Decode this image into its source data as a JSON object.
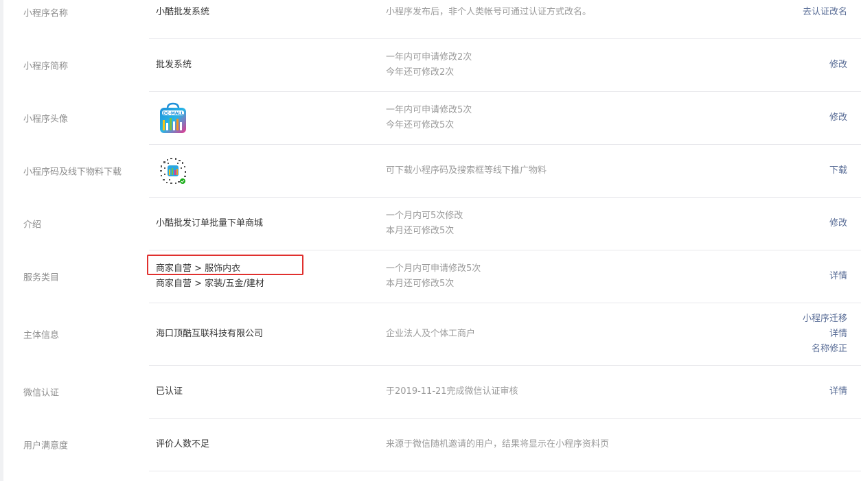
{
  "rows": [
    {
      "key": "name",
      "label": "小程序名称",
      "values": [
        "小酷批发系统"
      ],
      "desc": [
        "小程序发布后，非个人类帐号可通过认证方式改名。"
      ],
      "actions": [
        "去认证改名"
      ]
    },
    {
      "key": "short_name",
      "label": "小程序简称",
      "values": [
        "批发系统"
      ],
      "desc": [
        "一年内可申请修改2次",
        "今年还可修改2次"
      ],
      "actions": [
        "修改"
      ]
    },
    {
      "key": "avatar",
      "label": "小程序头像",
      "values": [],
      "desc": [
        "一年内可申请修改5次",
        "今年还可修改5次"
      ],
      "actions": [
        "修改"
      ],
      "avatar_text": "DC-MALL"
    },
    {
      "key": "qrcode",
      "label": "小程序码及线下物料下载",
      "values": [],
      "desc": [
        "可下载小程序码及搜索框等线下推广物料"
      ],
      "actions": [
        "下载"
      ]
    },
    {
      "key": "intro",
      "label": "介绍",
      "values": [
        "小酷批发订单批量下单商城"
      ],
      "desc": [
        "一个月内可5次修改",
        "本月还可修改5次"
      ],
      "actions": [
        "修改"
      ]
    },
    {
      "key": "category",
      "label": "服务类目",
      "values": [
        "商家自营 > 服饰内衣",
        "商家自营 > 家装/五金/建材"
      ],
      "desc": [
        "一个月内可申请修改5次",
        "本月还可修改5次"
      ],
      "actions": [
        "详情"
      ]
    },
    {
      "key": "entity",
      "label": "主体信息",
      "values": [
        "海口顶酷互联科技有限公司"
      ],
      "desc": [
        "企业法人及个体工商户"
      ],
      "actions": [
        "小程序迁移",
        "详情",
        "名称修正"
      ]
    },
    {
      "key": "wechat_cert",
      "label": "微信认证",
      "values": [
        "已认证"
      ],
      "desc": [
        "于2019-11-21完成微信认证审核"
      ],
      "actions": [
        "详情"
      ]
    },
    {
      "key": "satisfaction",
      "label": "用户满意度",
      "values": [
        "评价人数不足"
      ],
      "desc": [
        "来源于微信随机邀请的用户，结果将显示在小程序资料页"
      ],
      "actions": []
    }
  ],
  "colors": {
    "link": "#576b95",
    "label": "#8d8d8d",
    "value": "#353535",
    "desc": "#9a9a9a",
    "highlight": "#e0302e",
    "divider": "#e7e7eb"
  }
}
